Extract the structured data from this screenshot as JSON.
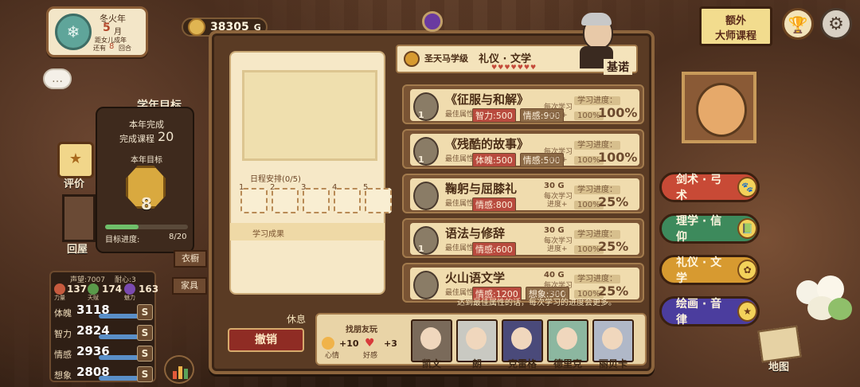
{
  "date": {
    "season": "冬火年",
    "month_num": "5",
    "month_unit": "月",
    "line1": "距女儿成年",
    "remaining_prefix": "还有",
    "remaining_num": "8",
    "remaining_suffix": "回合"
  },
  "gold": {
    "amount": "38305",
    "unit": "G"
  },
  "top_right": {
    "extra_course_line1": "额外",
    "extra_course_line2": "大师课程"
  },
  "left": {
    "year_goal_title": "学年目标",
    "year_done_label": "本年完成",
    "courses_label": "完成课程",
    "courses_value": "20",
    "target_label": "本年目标",
    "target_value": "8",
    "progress_label": "目标进度:",
    "progress_value": "8/20",
    "progress_fraction": 0.4,
    "eval_label": "评价",
    "home_label": "回屋",
    "wardrobe_label": "衣橱",
    "furniture_label": "家具"
  },
  "stats": {
    "reputation": "声望:7007",
    "patience": "耐心:3",
    "power": {
      "label": "力量",
      "value": "137"
    },
    "talent": {
      "label": "天赋",
      "value": "174"
    },
    "charm": {
      "label": "魅力",
      "value": "163"
    },
    "rows": [
      {
        "label": "体魄",
        "value": "3118",
        "grade": "S"
      },
      {
        "label": "智力",
        "value": "2824",
        "grade": "S"
      },
      {
        "label": "情感",
        "value": "2936",
        "grade": "S"
      },
      {
        "label": "想象",
        "value": "2808",
        "grade": "S"
      }
    ]
  },
  "schedule": {
    "label": "日程安排(0/5)",
    "slots": [
      "1",
      "2",
      "3",
      "4",
      "5"
    ],
    "result_label": "学习成果"
  },
  "teacher": {
    "school": "圣天马学级",
    "subject": "礼仪 · 文学",
    "name": "基诺"
  },
  "courses": [
    {
      "title": "《征服与和解》",
      "tag1": "智力:500",
      "tag2": "情感:900",
      "progress_label": "学习进度：",
      "progress": "100%",
      "per_label1": "每次学习",
      "per_label2": "进度+",
      "per_value": "100%",
      "best_label": "最佳属性:",
      "level": "1",
      "cost": ""
    },
    {
      "title": "《残酷的故事》",
      "tag1": "体魄:500",
      "tag2": "情感:500",
      "progress_label": "学习进度：",
      "progress": "100%",
      "per_label1": "每次学习",
      "per_label2": "进度+",
      "per_value": "100%",
      "best_label": "最佳属性:",
      "level": "1",
      "cost": ""
    },
    {
      "title": "鞠躬与屈膝礼",
      "tag1": "情感:800",
      "tag2": "",
      "progress_label": "学习进度：",
      "progress": "100%",
      "per_label1": "每次学习",
      "per_label2": "进度+",
      "per_value": "25%",
      "best_label": "最佳属性:",
      "level": "",
      "cost": "30 G"
    },
    {
      "title": "语法与修辞",
      "tag1": "情感:600",
      "tag2": "",
      "progress_label": "学习进度：",
      "progress": "100%",
      "per_label1": "每次学习",
      "per_label2": "进度+",
      "per_value": "25%",
      "best_label": "最佳属性:",
      "level": "1",
      "cost": "30 G"
    },
    {
      "title": "火山语文学",
      "tag1": "情感:1200",
      "tag2": "想象:300",
      "progress_label": "学习进度：",
      "progress": "100%",
      "per_label1": "每次学习",
      "per_label2": "进度+",
      "per_value": "25%",
      "best_label": "最佳属性:",
      "level": "",
      "cost": "40 G"
    }
  ],
  "hint": "达到最佳属性的话，每次学习的进度会更多。",
  "categories": [
    {
      "label": "剑术 · 弓术",
      "color": "#c84a36"
    },
    {
      "label": "理学 · 信仰",
      "color": "#3d8a5c"
    },
    {
      "label": "礼仪 · 文学",
      "color": "#d79a30"
    },
    {
      "label": "绘画 · 音律",
      "color": "#4b3d9e"
    }
  ],
  "bottom": {
    "rest_label": "休息",
    "cancel_label": "撤销",
    "find_friends_label": "找朋友玩",
    "mood_label": "心情",
    "mood_value": "+10",
    "favor_label": "好感",
    "favor_value": "+3",
    "friends": [
      "凯文",
      "朗",
      "克雷格",
      "德里克",
      "丽贝卡"
    ],
    "map_label": "地图"
  }
}
